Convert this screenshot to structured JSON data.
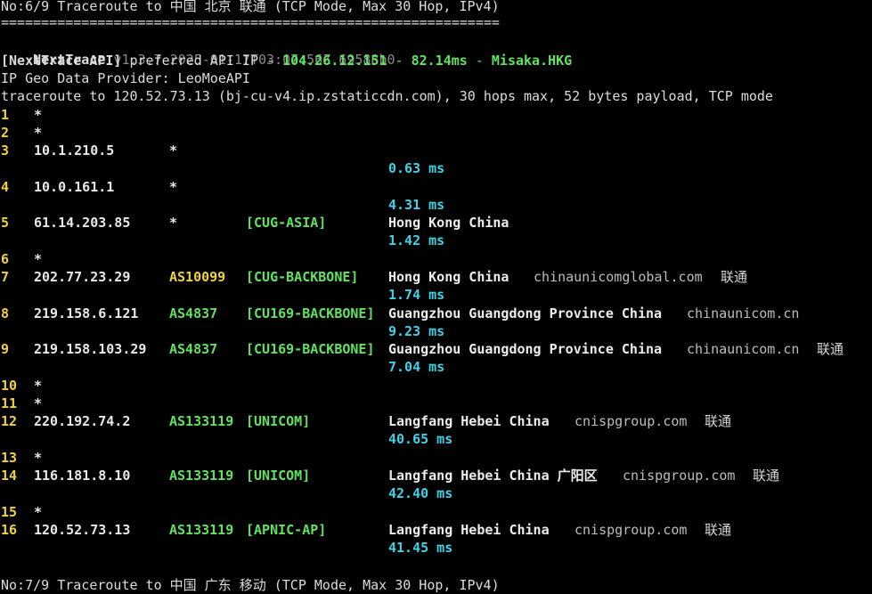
{
  "header_top": "No:6/9 Traceroute to 中国 北京 联通 (TCP Mode, Max 30 Hop, IPv4)",
  "separator": "==============================================================",
  "tool": {
    "name": "NextTrace",
    "version": "v1.3.7 2025-01-17T03:07:56Z 69588b0"
  },
  "api": {
    "label": "[NextTrace API]",
    "text": " preferred API IP - ",
    "ip": "104.26.12.151",
    "dash1": " - ",
    "latency": "82.14ms",
    "dash2": " - ",
    "node": "Misaka.HKG"
  },
  "geo_provider": "IP Geo Data Provider: LeoMoeAPI",
  "trace_line": "traceroute to 120.52.73.13 (bj-cu-v4.ip.zstaticcdn.com), 30 hops max, 52 bytes payload, TCP mode",
  "hops": [
    {
      "n": "1",
      "ip": "*"
    },
    {
      "n": "2",
      "ip": "*"
    },
    {
      "n": "3",
      "ip": "10.1.210.5",
      "as": "*",
      "latency": "0.63 ms"
    },
    {
      "n": "4",
      "ip": "10.0.161.1",
      "as": "*",
      "latency": "4.31 ms"
    },
    {
      "n": "5",
      "ip": "61.14.203.85",
      "as": "*",
      "tag": "[CUG-ASIA]",
      "geo": "Hong Kong China",
      "latency": "1.42 ms"
    },
    {
      "n": "6",
      "ip": "*"
    },
    {
      "n": "7",
      "ip": "202.77.23.29",
      "as": "AS10099",
      "tag": "[CUG-BACKBONE]",
      "geo": "Hong Kong China",
      "domain": "chinaunicomglobal.com",
      "isp": "联通",
      "latency": "1.74 ms"
    },
    {
      "n": "8",
      "ip": "219.158.6.121",
      "as": "AS4837",
      "tag": "[CU169-BACKBONE]",
      "geo": "Guangzhou Guangdong Province China",
      "domain": "chinaunicom.cn",
      "latency": "9.23 ms"
    },
    {
      "n": "9",
      "ip": "219.158.103.29",
      "as": "AS4837",
      "tag": "[CU169-BACKBONE]",
      "geo": "Guangzhou Guangdong Province China",
      "domain": "chinaunicom.cn",
      "isp": "联通",
      "latency": "7.04 ms"
    },
    {
      "n": "10",
      "ip": "*"
    },
    {
      "n": "11",
      "ip": "*"
    },
    {
      "n": "12",
      "ip": "220.192.74.2",
      "as": "AS133119",
      "tag": "[UNICOM]",
      "geo": "Langfang Hebei China",
      "domain": "cnispgroup.com",
      "isp": "联通",
      "latency": "40.65 ms"
    },
    {
      "n": "13",
      "ip": "*"
    },
    {
      "n": "14",
      "ip": "116.181.8.10",
      "as": "AS133119",
      "tag": "[UNICOM]",
      "geo": "Langfang Hebei China 广阳区",
      "domain": "cnispgroup.com",
      "isp": "联通",
      "latency": "42.40 ms"
    },
    {
      "n": "15",
      "ip": "*"
    },
    {
      "n": "16",
      "ip": "120.52.73.13",
      "as": "AS133119",
      "tag": "[APNIC-AP]",
      "geo": "Langfang Hebei China",
      "domain": "cnispgroup.com",
      "isp": "联通",
      "latency": "41.45 ms"
    }
  ],
  "header_bottom": "No:7/9 Traceroute to 中国 广东 移动 (TCP Mode, Max 30 Hop, IPv4)",
  "colors": {
    "background": "#000000",
    "green": "#5fe35f",
    "yellow": "#f0d23a",
    "cyan": "#3fd2e6",
    "gray": "#8a8a8a"
  }
}
